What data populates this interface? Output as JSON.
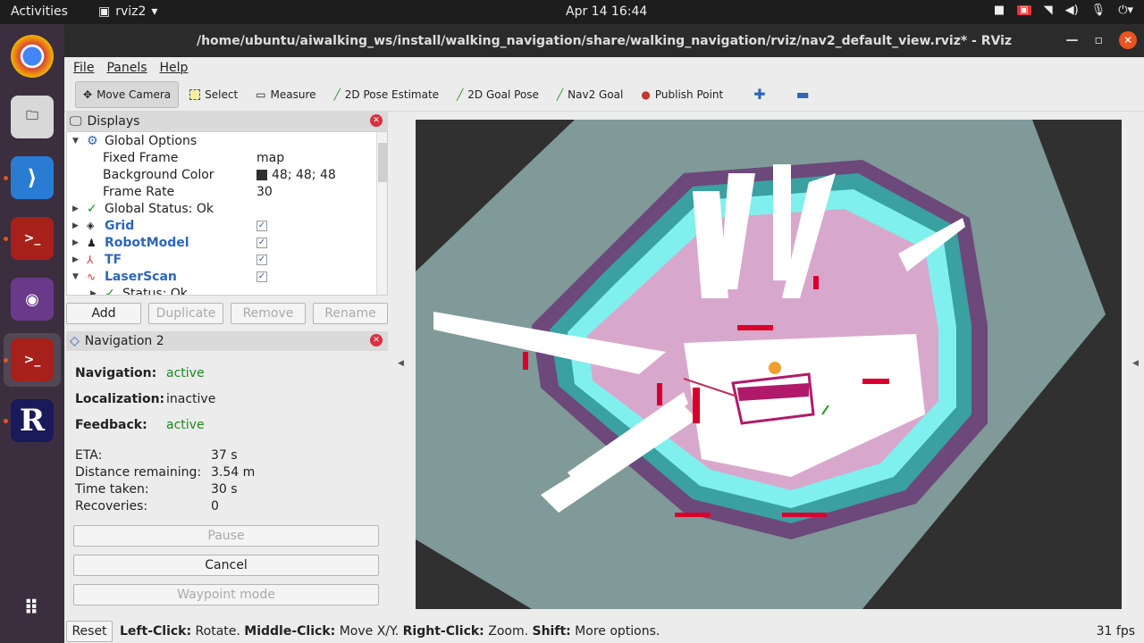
{
  "topbar": {
    "activities": "Activities",
    "app_name": "rviz2",
    "clock": "Apr 14  16:44"
  },
  "window": {
    "title": "/home/ubuntu/aiwalking_ws/install/walking_navigation/share/walking_navigation/rviz/nav2_default_view.rviz* - RViz"
  },
  "menu": [
    "File",
    "Panels",
    "Help"
  ],
  "toolbar": {
    "move_camera": "Move Camera",
    "select": "Select",
    "measure": "Measure",
    "pose_estimate": "2D Pose Estimate",
    "goal_pose": "2D Goal Pose",
    "nav2_goal": "Nav2 Goal",
    "publish_point": "Publish Point"
  },
  "displays": {
    "title": "Displays",
    "global_options": "Global Options",
    "fixed_frame_label": "Fixed Frame",
    "fixed_frame_value": "map",
    "bg_color_label": "Background Color",
    "bg_color_value": "48; 48; 48",
    "frame_rate_label": "Frame Rate",
    "frame_rate_value": "30",
    "global_status": "Global Status: Ok",
    "grid": "Grid",
    "robot_model": "RobotModel",
    "tf": "TF",
    "laser_scan": "LaserScan",
    "status": "Status: Ok",
    "add": "Add",
    "duplicate": "Duplicate",
    "remove": "Remove",
    "rename": "Rename"
  },
  "navigation": {
    "title": "Navigation 2",
    "navigation_label": "Navigation:",
    "navigation_value": "active",
    "localization_label": "Localization:",
    "localization_value": "inactive",
    "feedback_label": "Feedback:",
    "feedback_value": "active",
    "eta_label": "ETA:",
    "eta_value": "37 s",
    "distance_label": "Distance remaining:",
    "distance_value": "3.54 m",
    "time_label": "Time taken:",
    "time_value": "30 s",
    "recoveries_label": "Recoveries:",
    "recoveries_value": "0",
    "pause": "Pause",
    "cancel": "Cancel",
    "waypoint": "Waypoint mode"
  },
  "statusbar": {
    "reset": "Reset",
    "left_click": "Left-Click:",
    "left_click_action": " Rotate. ",
    "middle_click": "Middle-Click:",
    "middle_click_action": " Move X/Y. ",
    "right_click": "Right-Click:",
    "right_click_action": " Zoom. ",
    "shift": "Shift:",
    "shift_action": " More options.",
    "fps": "31 fps"
  },
  "colors": {
    "background": "#303030",
    "map_floor": "#7f9a98",
    "cost_cyan": "#7ff0ee",
    "cost_teal": "#3aa0a0",
    "cost_pink": "#d8a8cc",
    "cost_purple": "#6a3a74",
    "free": "#ffffff",
    "obstacle_red": "#d8002a",
    "accent": "#e95420"
  }
}
